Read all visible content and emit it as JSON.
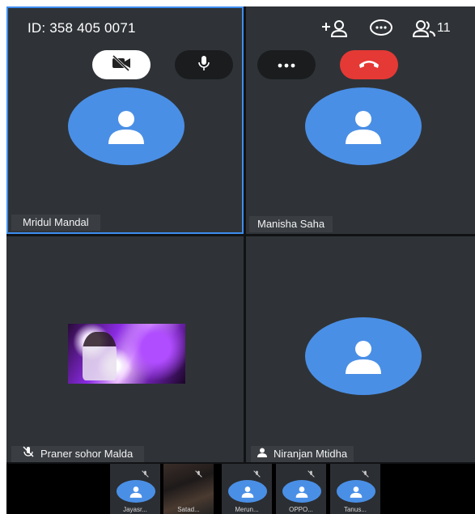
{
  "meeting": {
    "id_label": "ID: 358 405 0071"
  },
  "header": {
    "participant_count": "11"
  },
  "colors": {
    "accent": "#4a8fe6",
    "end_call": "#e53935",
    "active_border": "#3e8ef0",
    "tile_bg": "#2f3337"
  },
  "tiles": [
    {
      "name": "Mridul Mandal",
      "type": "avatar",
      "active": true
    },
    {
      "name": "Manisha Saha",
      "type": "avatar",
      "active": false
    },
    {
      "name": "Praner sohor Malda",
      "type": "photo",
      "muted": true
    },
    {
      "name": "Niranjan  Mtidha",
      "type": "avatar",
      "icon": "person-icon"
    }
  ],
  "strip": [
    {
      "name": "Jayasr...",
      "type": "avatar",
      "muted": true
    },
    {
      "name": "Satad...",
      "type": "photo",
      "muted": true
    },
    {
      "name": "Merun...",
      "type": "avatar",
      "muted": true
    },
    {
      "name": "OPPO...",
      "type": "avatar",
      "muted": true
    },
    {
      "name": "Tanus...",
      "type": "avatar",
      "muted": true
    }
  ],
  "icons": {
    "camera": "camera-off-icon",
    "mic": "microphone-icon",
    "more": "more-icon",
    "end": "end-call-icon",
    "add": "add-participant-icon",
    "chat": "chat-icon",
    "people": "participants-icon"
  }
}
